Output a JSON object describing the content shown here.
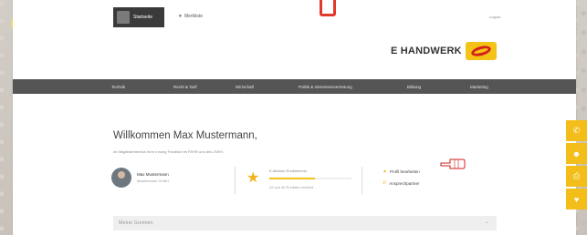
{
  "topbar": {
    "start_tab": "Startseite",
    "merkliste": "Merkliste",
    "logout": "Logout"
  },
  "logo": {
    "text": "E HANDWERK"
  },
  "nav": {
    "items": [
      "Technik",
      "Recht & Tarif",
      "Wirtschaft",
      "Politik & Interessenvertretung",
      "Bildung",
      "Marketing"
    ]
  },
  "main": {
    "welcome": "Willkommen Max Mustermann,",
    "subtext": "im Mitgliederbereich Ihrer Innung Frankfurt im FEHR und des ZVEH.",
    "person_name": "Max Mustermann",
    "person_role": "Mustermann GmbH",
    "points_title": "E-Marken-Punktekonto",
    "points_sub": "22 von 40 Punkten erreicht",
    "points_progress_fraction": 0.55,
    "action_profile": "Profil bearbeiten",
    "action_contact": "Ansprechpartner",
    "gremien": "Meine Gremien"
  },
  "colors": {
    "accent": "#f3bd1a",
    "nav_bg": "#555555",
    "logo_red": "#d5201a"
  },
  "icons": {
    "side": [
      "phone-icon",
      "user-icon",
      "printer-icon",
      "heart-icon"
    ]
  }
}
